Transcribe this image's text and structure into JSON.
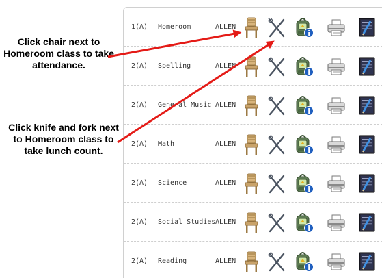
{
  "callouts": {
    "chair": "Click chair next to Homeroom class to take attendance.",
    "fork": "Click knife and fork next to Homeroom class to take lunch count."
  },
  "arrow_color": "#e41b17",
  "rows": [
    {
      "period": "1(A)",
      "name": "Homeroom",
      "teacher": "ALLEN"
    },
    {
      "period": "2(A)",
      "name": "Spelling",
      "teacher": "ALLEN"
    },
    {
      "period": "2(A)",
      "name": "General Music",
      "teacher": "ALLEN"
    },
    {
      "period": "2(A)",
      "name": "Math",
      "teacher": "ALLEN"
    },
    {
      "period": "2(A)",
      "name": "Science",
      "teacher": "ALLEN"
    },
    {
      "period": "2(A)",
      "name": "Social Studies",
      "teacher": "ALLEN"
    },
    {
      "period": "2(A)",
      "name": "Reading",
      "teacher": "ALLEN"
    }
  ],
  "icons": [
    "chair-icon",
    "knife-fork-icon",
    "backpack-info-icon",
    "printer-icon",
    "gradebook-icon"
  ]
}
